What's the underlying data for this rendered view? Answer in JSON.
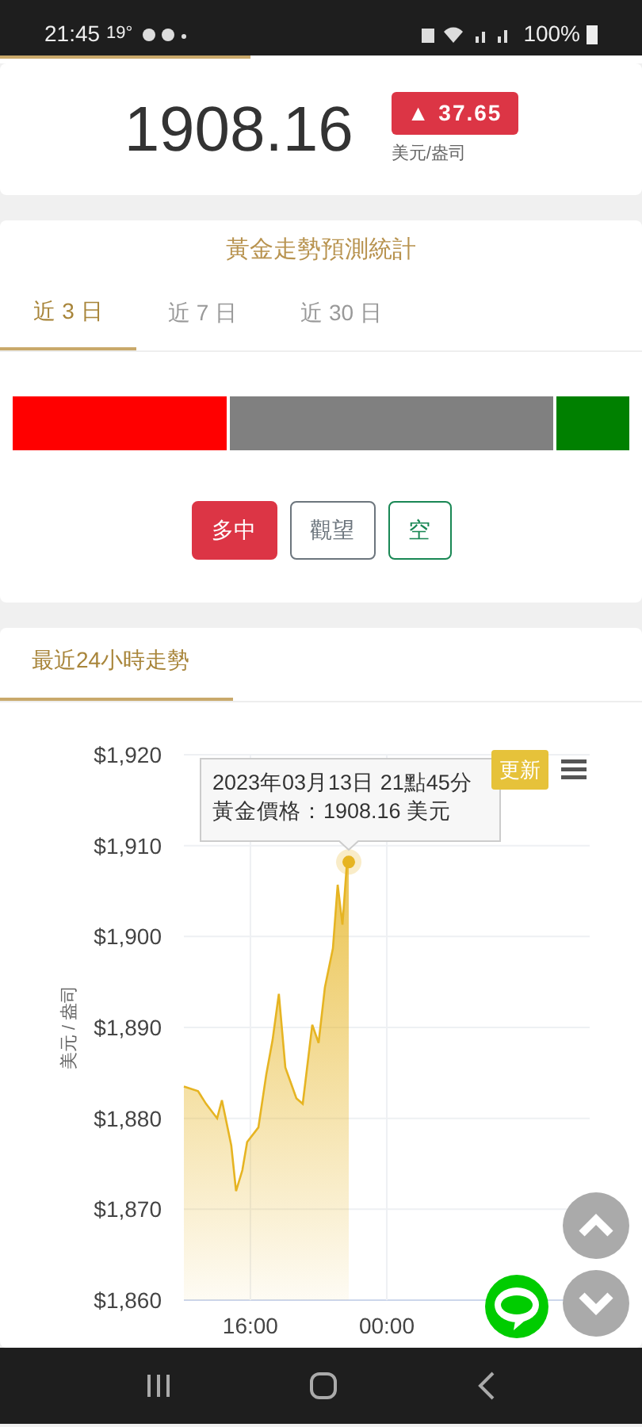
{
  "status_bar": {
    "time": "21:45",
    "temperature": "19°",
    "battery": "100%"
  },
  "quote": {
    "price": "1908.16",
    "change": "▲ 37.65",
    "unit": "美元/盎司"
  },
  "prediction": {
    "title": "黃金走勢預測統計",
    "tabs": [
      {
        "label": "近 3 日",
        "selected": true
      },
      {
        "label": "近 7 日",
        "selected": false
      },
      {
        "label": "近 30 日",
        "selected": false
      }
    ],
    "segments": [
      {
        "color": "#ff0000"
      },
      {
        "color": "#808080"
      },
      {
        "color": "#008000"
      }
    ],
    "buttons": [
      {
        "label": "多中",
        "color": "#dc3545",
        "selected": true
      },
      {
        "label": "觀望",
        "color": "#6c757d",
        "selected": false
      },
      {
        "label": "空",
        "color": "#198754",
        "selected": false
      }
    ]
  },
  "trend": {
    "tab": {
      "label": "最近24小時走勢",
      "selected": true
    },
    "refresh_button": "更新",
    "tooltip": [
      "2023年03月13日 21點45分",
      "黃金價格：1908.16 美元"
    ],
    "chart_data": {
      "type": "area",
      "ylabel": "美元 / 盎司",
      "x": [
        12.1,
        12.93,
        13.4,
        14.05,
        14.33,
        14.88,
        15.16,
        15.53,
        15.81,
        16.47,
        16.93,
        17.3,
        17.67,
        18.05,
        18.7,
        19.07,
        19.63,
        20,
        20.37,
        20.84,
        21.12,
        21.4,
        21.67,
        21.77
      ],
      "series": [
        {
          "color": "#e6b422",
          "values": [
            1883.5,
            1883,
            1881.6,
            1880,
            1882,
            1877,
            1872,
            1874.3,
            1877.4,
            1879,
            1884.8,
            1888.6,
            1893.7,
            1885.6,
            1882.2,
            1881.6,
            1890.3,
            1888.3,
            1894.4,
            1898.7,
            1905.7,
            1901.3,
            1908.3,
            1908.2
          ]
        }
      ],
      "xlim": [
        12.1,
        35.9
      ],
      "ylim": [
        1860,
        1920
      ],
      "grid": true,
      "xticks": [
        {
          "value": 16,
          "label": "16:00"
        },
        {
          "value": 24,
          "label": "00:00"
        }
      ],
      "yticks": [
        {
          "value": 1860,
          "label": "$1,860"
        },
        {
          "value": 1870,
          "label": "$1,870"
        },
        {
          "value": 1880,
          "label": "$1,880"
        },
        {
          "value": 1890,
          "label": "$1,890"
        },
        {
          "value": 1900,
          "label": "$1,900"
        },
        {
          "value": 1910,
          "label": "$1,910"
        },
        {
          "value": 1920,
          "label": "$1,920"
        }
      ]
    }
  }
}
